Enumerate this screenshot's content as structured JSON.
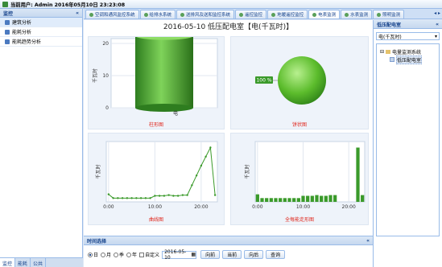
{
  "header": {
    "title": "当前用户: Admin  2016年05月10日 23:23:08"
  },
  "left": {
    "title": "监控",
    "collapse": "«",
    "items": [
      "建筑分析",
      "能耗分析",
      "能耗趋势分析"
    ],
    "tabs": [
      "监控",
      "能耗",
      "公共"
    ]
  },
  "tabs": [
    "空调和通风监控系统",
    "给排水系统",
    "送排风及送和监控系统",
    "遥控监控",
    "地暖遥控监控",
    "电表监测",
    "水表监测",
    "照明监测"
  ],
  "tab_scroll": "◂ ▸",
  "main": {
    "title": "2016-05-10 低压配电室【电(千瓦时)】",
    "up_icon": "⇧",
    "captions": [
      "柱形图",
      "饼状图",
      "曲线图",
      "全每能走形图"
    ],
    "ylabel": "千瓦时",
    "bar_value_label": "22.35",
    "bar_category": "电",
    "pie_label": "100 %"
  },
  "colors": {
    "green": "#3a9a2a",
    "panel": "#dfe8f6",
    "caption": "#e0261b"
  },
  "chart_data": [
    {
      "type": "bar",
      "categories": [
        "电"
      ],
      "values": [
        22.35
      ],
      "ylabel": "千瓦时",
      "ylim": [
        0,
        20
      ],
      "yticks": [
        0,
        10,
        20
      ],
      "data_label": "22.35"
    },
    {
      "type": "pie",
      "slices": [
        {
          "label": "电",
          "value": 100
        }
      ],
      "data_label": "100 %"
    },
    {
      "type": "line",
      "x": [
        "0:00",
        "1:00",
        "2:00",
        "3:00",
        "4:00",
        "5:00",
        "6:00",
        "7:00",
        "8:00",
        "9:00",
        "10:00",
        "11:00",
        "12:00",
        "13:00",
        "14:00",
        "15:00",
        "16:00",
        "17:00",
        "18:00",
        "19:00",
        "20:00",
        "21:00",
        "22:00",
        "23:00"
      ],
      "values": [
        1.0,
        0.5,
        0.5,
        0.5,
        0.5,
        0.5,
        0.5,
        0.5,
        0.5,
        0.5,
        0.8,
        0.8,
        0.8,
        0.9,
        0.8,
        0.8,
        0.9,
        0.9,
        2.2,
        3.5,
        4.8,
        6.0,
        7.2,
        0.9
      ],
      "ylabel": "千瓦时",
      "ylim": [
        0,
        8
      ],
      "xticks": [
        "0:00",
        "10:00",
        "20:00"
      ]
    },
    {
      "type": "bar",
      "x": [
        "0:00",
        "1:00",
        "2:00",
        "3:00",
        "4:00",
        "5:00",
        "6:00",
        "7:00",
        "8:00",
        "9:00",
        "10:00",
        "11:00",
        "12:00",
        "13:00",
        "14:00",
        "15:00",
        "16:00",
        "17:00",
        "18:00",
        "19:00",
        "20:00",
        "21:00",
        "22:00",
        "23:00"
      ],
      "values": [
        1.0,
        0.5,
        0.5,
        0.5,
        0.5,
        0.5,
        0.5,
        0.5,
        0.5,
        0.5,
        0.8,
        0.8,
        0.8,
        0.9,
        0.8,
        0.8,
        0.9,
        0.9,
        0,
        0,
        0,
        0,
        7.2,
        0.9
      ],
      "ylabel": "千瓦时",
      "ylim": [
        0,
        8
      ],
      "xticks": [
        "0:00",
        "10:00",
        "20:00"
      ]
    }
  ],
  "bottom": {
    "title": "时间选择",
    "collapse": "«",
    "radios": [
      "日",
      "月",
      "季",
      "年",
      "自定义"
    ],
    "date": "2016-05-10",
    "date_icon": "▦",
    "buttons": [
      "向前",
      "当前",
      "向后",
      "查询"
    ]
  },
  "right": {
    "title": "低压配电室",
    "collapse": "«",
    "select": "电(千瓦时)",
    "select_arrow": "▾",
    "tree": {
      "root": "电量监测系统",
      "child": "低压配电室",
      "expander": "⊟"
    }
  }
}
